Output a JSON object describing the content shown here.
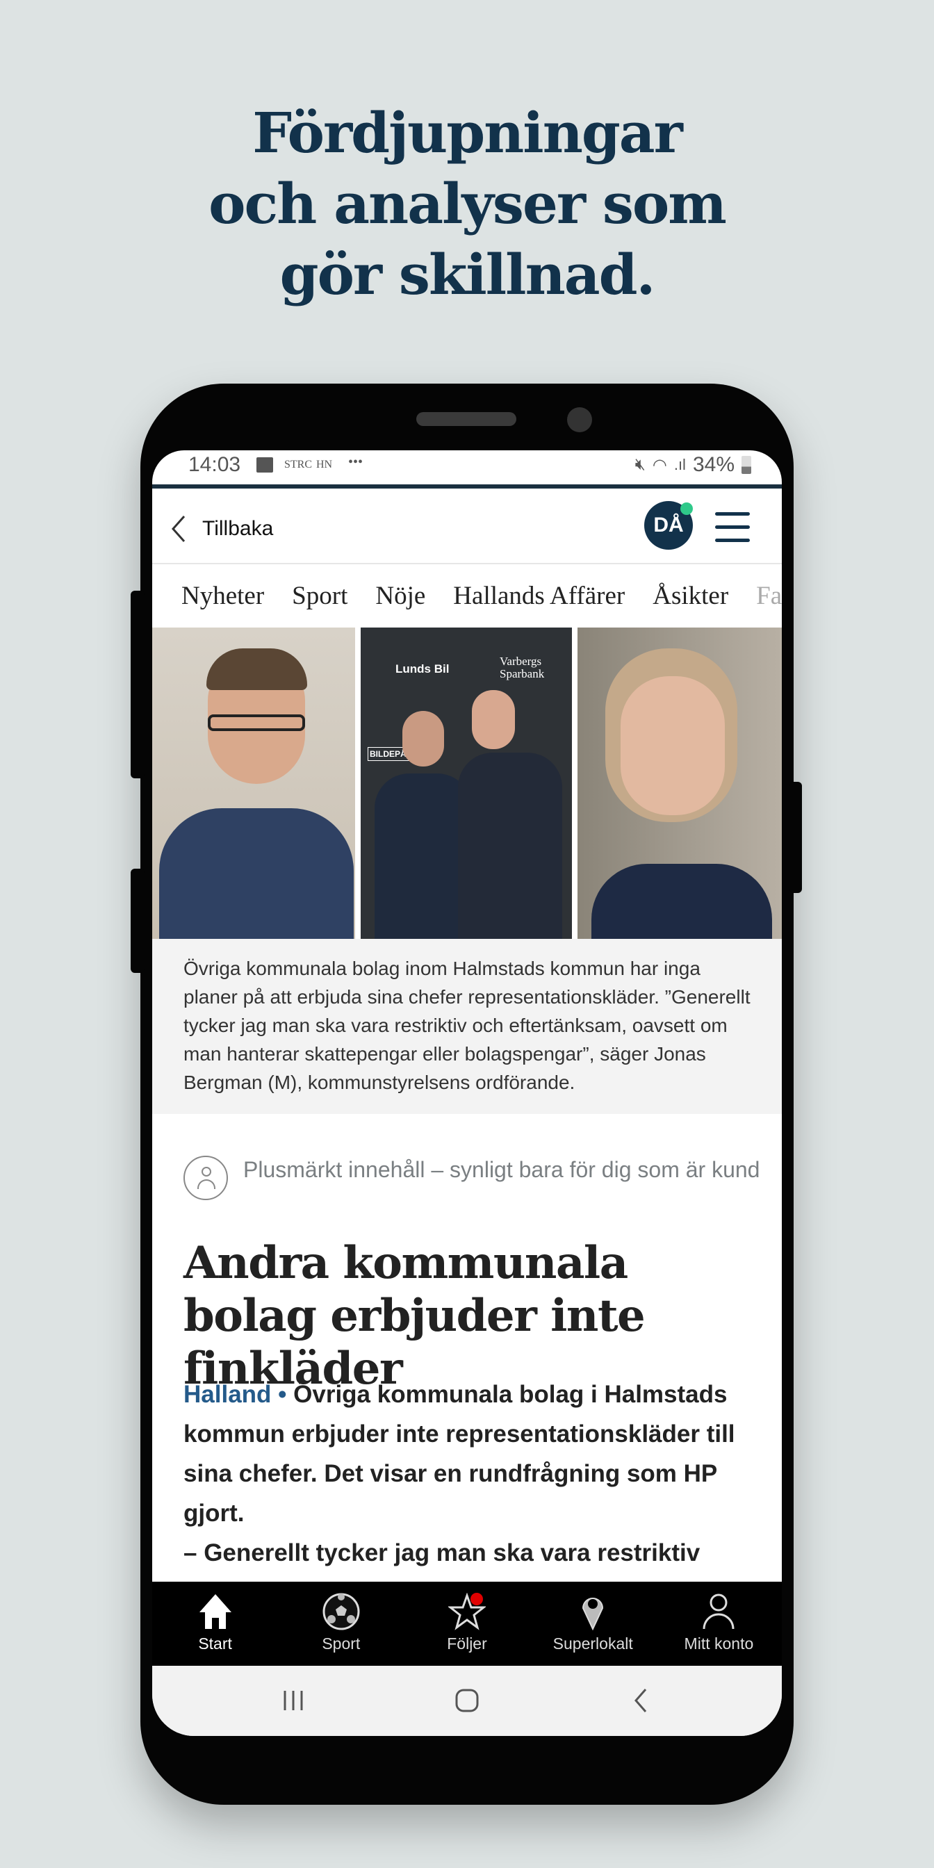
{
  "promo": {
    "headline_lines": [
      "Fördjupningar",
      "och analyser som",
      "gör skillnad."
    ]
  },
  "status_bar": {
    "time": "14:03",
    "notif_labels": [
      "STRC",
      "HN"
    ],
    "more": "•••",
    "battery": "34%"
  },
  "header": {
    "back_label": "Tillbaka",
    "avatar_initials": "DÅ",
    "accent": "#12324b",
    "online_color": "#2fc98a"
  },
  "sections": [
    "Nyheter",
    "Sport",
    "Nöje",
    "Hallands Affärer",
    "Åsikter",
    "Familj"
  ],
  "photo": {
    "sponsor_texts": [
      "Lunds Bil",
      "Varbergs Sparbank",
      "BILDEPÅN"
    ]
  },
  "caption": "Övriga kommunala bolag inom Halmstads kommun har inga planer på att erbjuda sina chefer representationskläder. ”Generellt tycker jag man ska vara restriktiv och eftertänksam, oavsett om man hanterar skattepengar eller bolagspengar”, säger Jonas Bergman (M), kommunstyrelsens ordförande.",
  "article": {
    "plus_notice": "Plusmärkt innehåll – synligt bara för dig som är kund",
    "title": "Andra kommunala bolag erbjuder inte finkläder",
    "location": "Halland •",
    "lede": " Övriga kommunala bolag i Halmstads kommun erbjuder inte representationskläder till sina chefer. Det visar en rundfrågning som HP gjort.",
    "lede_quote": "– Generellt tycker jag man ska vara restriktiv"
  },
  "bottom_nav": [
    {
      "label": "Start",
      "icon": "home-icon",
      "active": true
    },
    {
      "label": "Sport",
      "icon": "soccer-ball-icon"
    },
    {
      "label": "Följer",
      "icon": "star-icon",
      "badge_color": "#e00000"
    },
    {
      "label": "Superlokalt",
      "icon": "location-pin-icon"
    },
    {
      "label": "Mitt konto",
      "icon": "person-icon"
    }
  ]
}
